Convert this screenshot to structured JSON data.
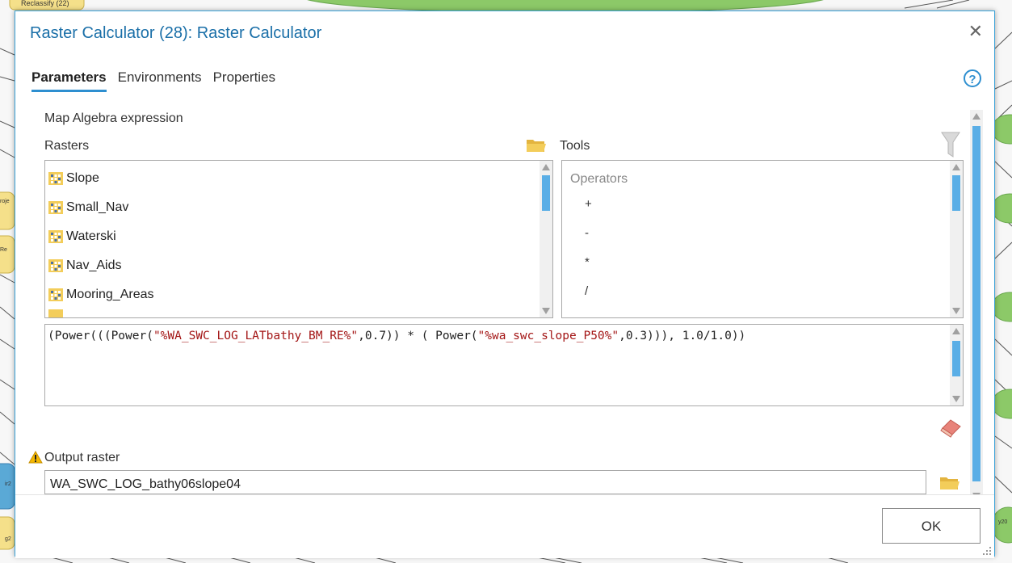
{
  "background": {
    "node_label": "Reclassify (22)",
    "side_labels": [
      "roje",
      "Re",
      "ir2",
      "g2",
      "y20"
    ]
  },
  "dialog": {
    "title": "Raster Calculator (28): Raster Calculator",
    "tabs": [
      {
        "label": "Parameters",
        "active": true
      },
      {
        "label": "Environments",
        "active": false
      },
      {
        "label": "Properties",
        "active": false
      }
    ],
    "help_symbol": "?",
    "expression_label": "Map Algebra expression",
    "rasters_label": "Rasters",
    "tools_label": "Tools",
    "rasters": [
      "Slope",
      "Small_Nav",
      "Waterski",
      "Nav_Aids",
      "Mooring_Areas"
    ],
    "operators_header": "Operators",
    "operators": [
      "+",
      "-",
      "*",
      "/"
    ],
    "expression": {
      "p1": "(Power(((Power(",
      "s1": "\"%WA_SWC_LOG_LATbathy_BM_RE%\"",
      "p2": ",0.7)) * ( Power(",
      "s2": "\"%wa_swc_slope_P50%\"",
      "p3": ",0.3))), 1.0/1.0))"
    },
    "output_label": "Output raster",
    "output_value": "WA_SWC_LOG_bathy06slope04",
    "ok_label": "OK"
  },
  "colors": {
    "accent": "#2e8fd0",
    "title": "#1a6fa8",
    "string_literal": "#a31515",
    "scroll_thumb": "#5aaee6",
    "model_node_green": "#8cc968",
    "model_node_yellow": "#f5e08a",
    "model_node_blue": "#5aa9d6"
  }
}
